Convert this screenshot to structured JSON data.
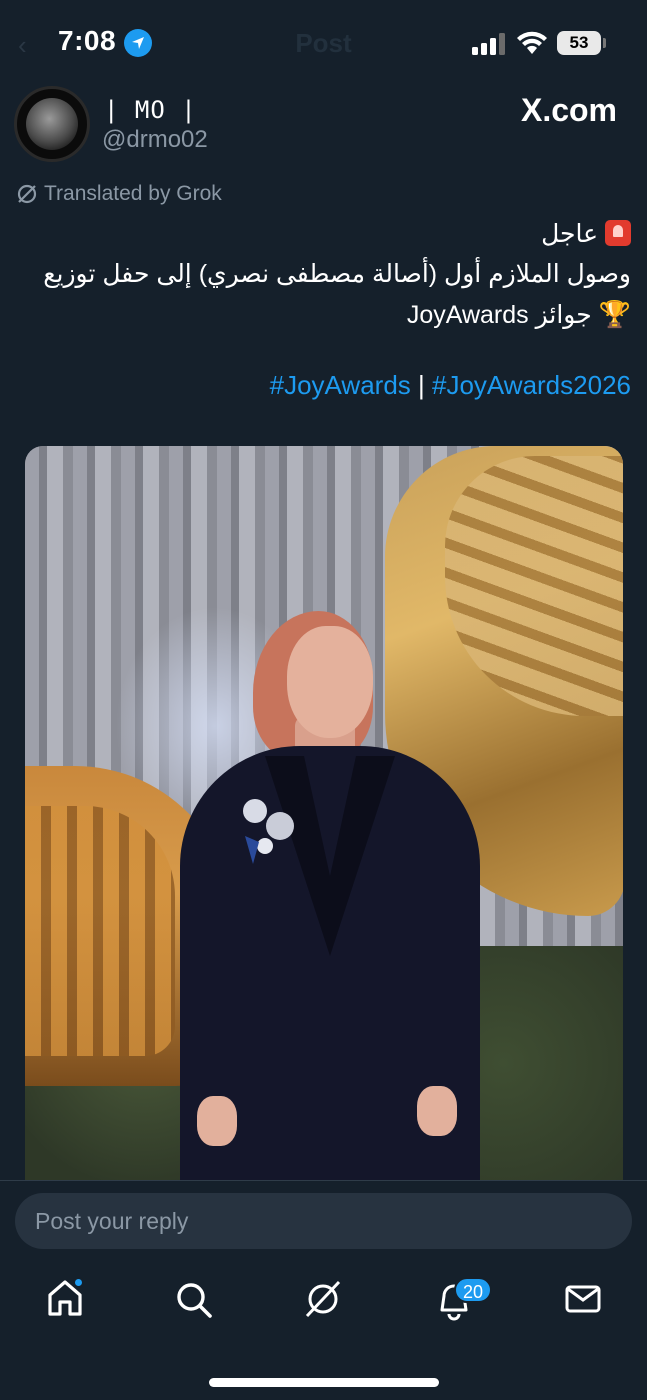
{
  "status_bar": {
    "time": "7:08",
    "battery": "53",
    "faded_title": "Post",
    "faded_back": "‹"
  },
  "author": {
    "name": "| MO |",
    "handle": "@drmo02"
  },
  "brand": "X.com",
  "translated_label": "Translated by Grok",
  "post": {
    "line1": "عاجل",
    "line2": "وصول الملازم أول (أصالة مصطفى نصري) إلى حفل توزيع",
    "line3": "جوائز JoyAwards",
    "hashtag1": "#JoyAwards",
    "separator": " | ",
    "hashtag2": "#JoyAwards2026"
  },
  "reply": {
    "placeholder": "Post your reply"
  },
  "tabs": {
    "notifications_badge": "20"
  },
  "colors": {
    "background": "#15202b",
    "accent": "#1d9bf0",
    "muted": "#8b98a5"
  }
}
